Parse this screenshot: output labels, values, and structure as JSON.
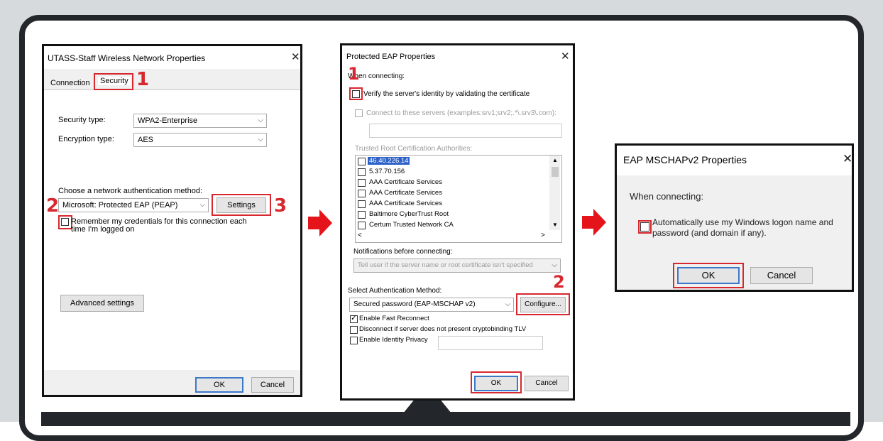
{
  "dialog1": {
    "title": "UTASS-Staff Wireless Network Properties",
    "tabs": [
      "Connection",
      "Security"
    ],
    "security_type_label": "Security type:",
    "security_type_value": "WPA2-Enterprise",
    "encryption_type_label": "Encryption type:",
    "encryption_type_value": "AES",
    "auth_method_label": "Choose a network authentication method:",
    "auth_method_value": "Microsoft: Protected EAP (PEAP)",
    "settings_button": "Settings",
    "remember_label": "Remember my credentials for this connection each time I'm logged on",
    "advanced_button": "Advanced settings",
    "ok_button": "OK",
    "cancel_button": "Cancel",
    "step_numbers": [
      "1",
      "2",
      "3"
    ]
  },
  "dialog2": {
    "title": "Protected EAP Properties",
    "when_connecting": "When connecting:",
    "verify_label": "Verify the server's identity by validating the certificate",
    "connect_servers_label": "Connect to these servers (examples:srv1;srv2;.*\\.srv3\\.com):",
    "trusted_root_label": "Trusted Root Certification Authorities:",
    "cert_list": [
      "46.40.226.14",
      "5.37.70.156",
      "AAA Certificate Services",
      "AAA Certificate Services",
      "AAA Certificate Services",
      "Baltimore CyberTrust Root",
      "Certum Trusted Network CA"
    ],
    "notifications_label": "Notifications before connecting:",
    "notifications_value": "Tell user if the server name or root certificate isn't specified",
    "select_auth_label": "Select Authentication Method:",
    "auth_value": "Secured password (EAP-MSCHAP v2)",
    "configure_button": "Configure...",
    "options": [
      "Enable Fast Reconnect",
      "Disconnect if server does not present cryptobinding TLV",
      "Enable Identity Privacy"
    ],
    "options_checked": [
      true,
      false,
      false
    ],
    "ok_button": "OK",
    "cancel_button": "Cancel",
    "step_numbers": [
      "1",
      "2"
    ]
  },
  "dialog3": {
    "title": "EAP MSCHAPv2 Properties",
    "when_connecting": "When connecting:",
    "auto_label_line1": "Automatically use my Windows logon name and",
    "auto_label_line2": "password (and domain if any).",
    "ok_button": "OK",
    "cancel_button": "Cancel"
  },
  "colors": {
    "accent_red": "#d7282f",
    "frame_dark": "#23262b",
    "arrow_red": "#e5141b"
  }
}
